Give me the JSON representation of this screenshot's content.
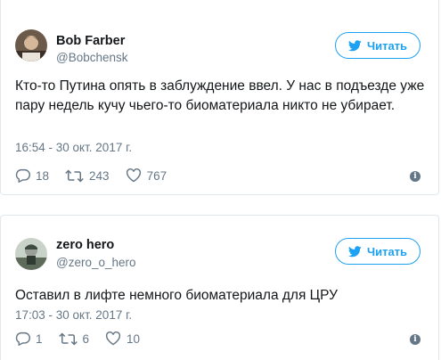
{
  "tweets": [
    {
      "name": "Bob Farber",
      "handle": "@Bobchensk",
      "follow_label": "Читать",
      "text": "Кто-то Путина опять в заблуждение ввел. У нас в подъезде уже пару недель кучу чьего-то биоматериала никто не убирает.",
      "timestamp": "16:54 - 30 окт. 2017 г.",
      "replies": "18",
      "retweets": "243",
      "likes": "767"
    },
    {
      "name": "zero hero",
      "handle": "@zero_o_hero",
      "follow_label": "Читать",
      "text": "Оставил в лифте немного биоматериала для ЦРУ",
      "timestamp": "17:03 - 30 окт. 2017 г.",
      "replies": "1",
      "retweets": "6",
      "likes": "10"
    }
  ],
  "colors": {
    "accent": "#1da1f2",
    "secondary_text": "#657786",
    "border": "#e1e8ed"
  },
  "icons": [
    "twitter-bird-icon",
    "reply-icon",
    "retweet-icon",
    "heart-icon",
    "info-icon"
  ]
}
